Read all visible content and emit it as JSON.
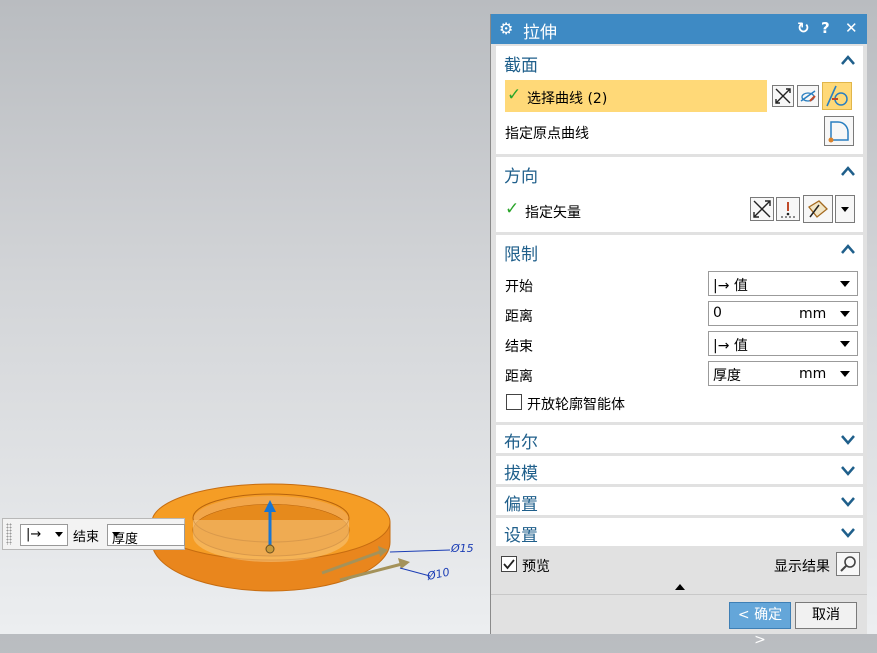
{
  "viewport": {
    "dimension_1": "Ø15",
    "dimension_2": "Ø10",
    "editbar": {
      "limit_symbol": "|→",
      "label": "结束",
      "value": "厚度"
    }
  },
  "dialog": {
    "title": "拉伸",
    "icons": [
      "gear-icon",
      "reset-icon",
      "help-icon",
      "close-icon"
    ],
    "help_label": "?",
    "close_label": "✕",
    "sections": {
      "section": {
        "header": "截面",
        "select_curve": "选择曲线 (2)",
        "origin_curve": "指定原点曲线"
      },
      "direction": {
        "header": "方向",
        "specify_vector": "指定矢量"
      },
      "limits": {
        "header": "限制",
        "start_label": "开始",
        "start_value": "|→ 值",
        "start_distance_label": "距离",
        "start_distance_value": "0",
        "start_distance_unit": "mm",
        "end_label": "结束",
        "end_value": "|→ 值",
        "end_distance_label": "距离",
        "end_distance_value": "厚度",
        "end_distance_unit": "mm",
        "open_profile_label": "开放轮廓智能体",
        "open_profile_checked": false
      },
      "boolean": {
        "header": "布尔"
      },
      "draft": {
        "header": "拔模"
      },
      "offset": {
        "header": "偏置"
      },
      "settings": {
        "header": "设置"
      }
    },
    "preview_label": "预览",
    "preview_checked": true,
    "show_result_label": "显示结果",
    "ok_label": "< 确定 >",
    "cancel_label": "取消"
  },
  "colors": {
    "title_bar": "#3e8ac4",
    "highlight": "#ffd978",
    "section_header": "#1f5f8b",
    "ring": "#f39a22",
    "ok_button": "#64a6d9"
  }
}
